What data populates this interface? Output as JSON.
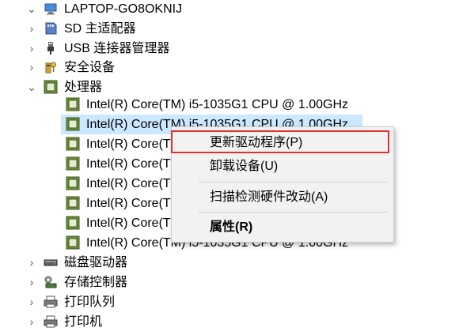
{
  "tree": {
    "root": {
      "label": "LAPTOP-GO8OKNIJ",
      "expander": "expanded",
      "icon": "computer-icon"
    },
    "categories_top": [
      {
        "label": "SD 主适配器",
        "icon": "sd-adapter-icon"
      },
      {
        "label": "USB 连接器管理器",
        "icon": "usb-icon"
      },
      {
        "label": "安全设备",
        "icon": "security-device-icon"
      }
    ],
    "processors": {
      "label": "处理器",
      "icon": "processor-icon",
      "items": [
        "Intel(R) Core(TM) i5-1035G1 CPU @ 1.00GHz",
        "Intel(R) Core(TM) i5-1035G1 CPU @ 1.00GHz",
        "Intel(R) Core(T",
        "Intel(R) Core(T",
        "Intel(R) Core(T",
        "Intel(R) Core(T",
        "Intel(R) Core(T",
        "Intel(R) Core(TM) i5-1035G1 CPU @ 1.00GHz"
      ]
    },
    "categories_bottom": [
      {
        "label": "磁盘驱动器",
        "icon": "disk-drive-icon"
      },
      {
        "label": "存储控制器",
        "icon": "storage-controller-icon"
      },
      {
        "label": "打印队列",
        "icon": "print-queue-icon"
      },
      {
        "label": "打印机",
        "icon": "printer-icon"
      }
    ]
  },
  "context_menu": {
    "update_driver": "更新驱动程序(P)",
    "uninstall": "卸载设备(U)",
    "scan": "扫描检测硬件改动(A)",
    "properties": "属性(R)"
  },
  "colors": {
    "selection": "#cce8ff",
    "highlight_border": "#e03030",
    "menu_bg": "#f2f2f2"
  }
}
